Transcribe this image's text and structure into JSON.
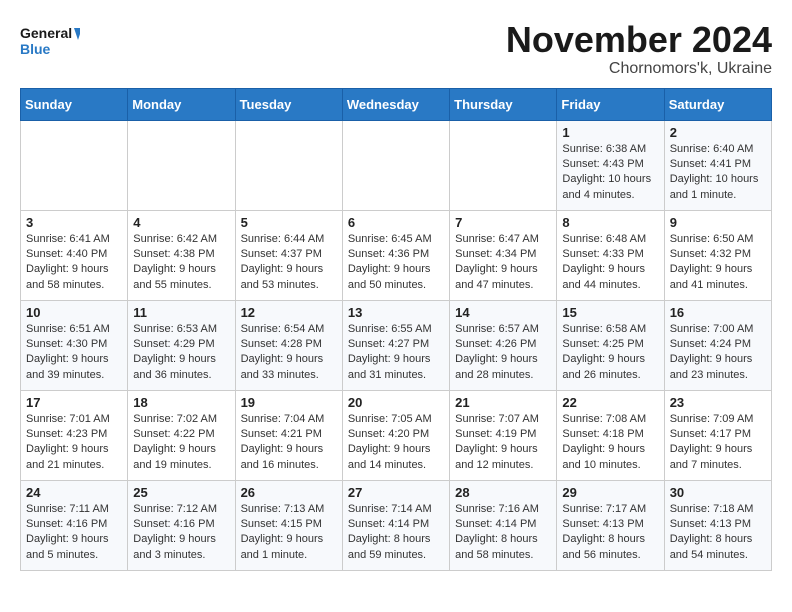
{
  "logo": {
    "line1": "General",
    "line2": "Blue"
  },
  "title": "November 2024",
  "location": "Chornomors'k, Ukraine",
  "days_of_week": [
    "Sunday",
    "Monday",
    "Tuesday",
    "Wednesday",
    "Thursday",
    "Friday",
    "Saturday"
  ],
  "weeks": [
    [
      {
        "day": "",
        "info": ""
      },
      {
        "day": "",
        "info": ""
      },
      {
        "day": "",
        "info": ""
      },
      {
        "day": "",
        "info": ""
      },
      {
        "day": "",
        "info": ""
      },
      {
        "day": "1",
        "info": "Sunrise: 6:38 AM\nSunset: 4:43 PM\nDaylight: 10 hours and 4 minutes."
      },
      {
        "day": "2",
        "info": "Sunrise: 6:40 AM\nSunset: 4:41 PM\nDaylight: 10 hours and 1 minute."
      }
    ],
    [
      {
        "day": "3",
        "info": "Sunrise: 6:41 AM\nSunset: 4:40 PM\nDaylight: 9 hours and 58 minutes."
      },
      {
        "day": "4",
        "info": "Sunrise: 6:42 AM\nSunset: 4:38 PM\nDaylight: 9 hours and 55 minutes."
      },
      {
        "day": "5",
        "info": "Sunrise: 6:44 AM\nSunset: 4:37 PM\nDaylight: 9 hours and 53 minutes."
      },
      {
        "day": "6",
        "info": "Sunrise: 6:45 AM\nSunset: 4:36 PM\nDaylight: 9 hours and 50 minutes."
      },
      {
        "day": "7",
        "info": "Sunrise: 6:47 AM\nSunset: 4:34 PM\nDaylight: 9 hours and 47 minutes."
      },
      {
        "day": "8",
        "info": "Sunrise: 6:48 AM\nSunset: 4:33 PM\nDaylight: 9 hours and 44 minutes."
      },
      {
        "day": "9",
        "info": "Sunrise: 6:50 AM\nSunset: 4:32 PM\nDaylight: 9 hours and 41 minutes."
      }
    ],
    [
      {
        "day": "10",
        "info": "Sunrise: 6:51 AM\nSunset: 4:30 PM\nDaylight: 9 hours and 39 minutes."
      },
      {
        "day": "11",
        "info": "Sunrise: 6:53 AM\nSunset: 4:29 PM\nDaylight: 9 hours and 36 minutes."
      },
      {
        "day": "12",
        "info": "Sunrise: 6:54 AM\nSunset: 4:28 PM\nDaylight: 9 hours and 33 minutes."
      },
      {
        "day": "13",
        "info": "Sunrise: 6:55 AM\nSunset: 4:27 PM\nDaylight: 9 hours and 31 minutes."
      },
      {
        "day": "14",
        "info": "Sunrise: 6:57 AM\nSunset: 4:26 PM\nDaylight: 9 hours and 28 minutes."
      },
      {
        "day": "15",
        "info": "Sunrise: 6:58 AM\nSunset: 4:25 PM\nDaylight: 9 hours and 26 minutes."
      },
      {
        "day": "16",
        "info": "Sunrise: 7:00 AM\nSunset: 4:24 PM\nDaylight: 9 hours and 23 minutes."
      }
    ],
    [
      {
        "day": "17",
        "info": "Sunrise: 7:01 AM\nSunset: 4:23 PM\nDaylight: 9 hours and 21 minutes."
      },
      {
        "day": "18",
        "info": "Sunrise: 7:02 AM\nSunset: 4:22 PM\nDaylight: 9 hours and 19 minutes."
      },
      {
        "day": "19",
        "info": "Sunrise: 7:04 AM\nSunset: 4:21 PM\nDaylight: 9 hours and 16 minutes."
      },
      {
        "day": "20",
        "info": "Sunrise: 7:05 AM\nSunset: 4:20 PM\nDaylight: 9 hours and 14 minutes."
      },
      {
        "day": "21",
        "info": "Sunrise: 7:07 AM\nSunset: 4:19 PM\nDaylight: 9 hours and 12 minutes."
      },
      {
        "day": "22",
        "info": "Sunrise: 7:08 AM\nSunset: 4:18 PM\nDaylight: 9 hours and 10 minutes."
      },
      {
        "day": "23",
        "info": "Sunrise: 7:09 AM\nSunset: 4:17 PM\nDaylight: 9 hours and 7 minutes."
      }
    ],
    [
      {
        "day": "24",
        "info": "Sunrise: 7:11 AM\nSunset: 4:16 PM\nDaylight: 9 hours and 5 minutes."
      },
      {
        "day": "25",
        "info": "Sunrise: 7:12 AM\nSunset: 4:16 PM\nDaylight: 9 hours and 3 minutes."
      },
      {
        "day": "26",
        "info": "Sunrise: 7:13 AM\nSunset: 4:15 PM\nDaylight: 9 hours and 1 minute."
      },
      {
        "day": "27",
        "info": "Sunrise: 7:14 AM\nSunset: 4:14 PM\nDaylight: 8 hours and 59 minutes."
      },
      {
        "day": "28",
        "info": "Sunrise: 7:16 AM\nSunset: 4:14 PM\nDaylight: 8 hours and 58 minutes."
      },
      {
        "day": "29",
        "info": "Sunrise: 7:17 AM\nSunset: 4:13 PM\nDaylight: 8 hours and 56 minutes."
      },
      {
        "day": "30",
        "info": "Sunrise: 7:18 AM\nSunset: 4:13 PM\nDaylight: 8 hours and 54 minutes."
      }
    ]
  ]
}
